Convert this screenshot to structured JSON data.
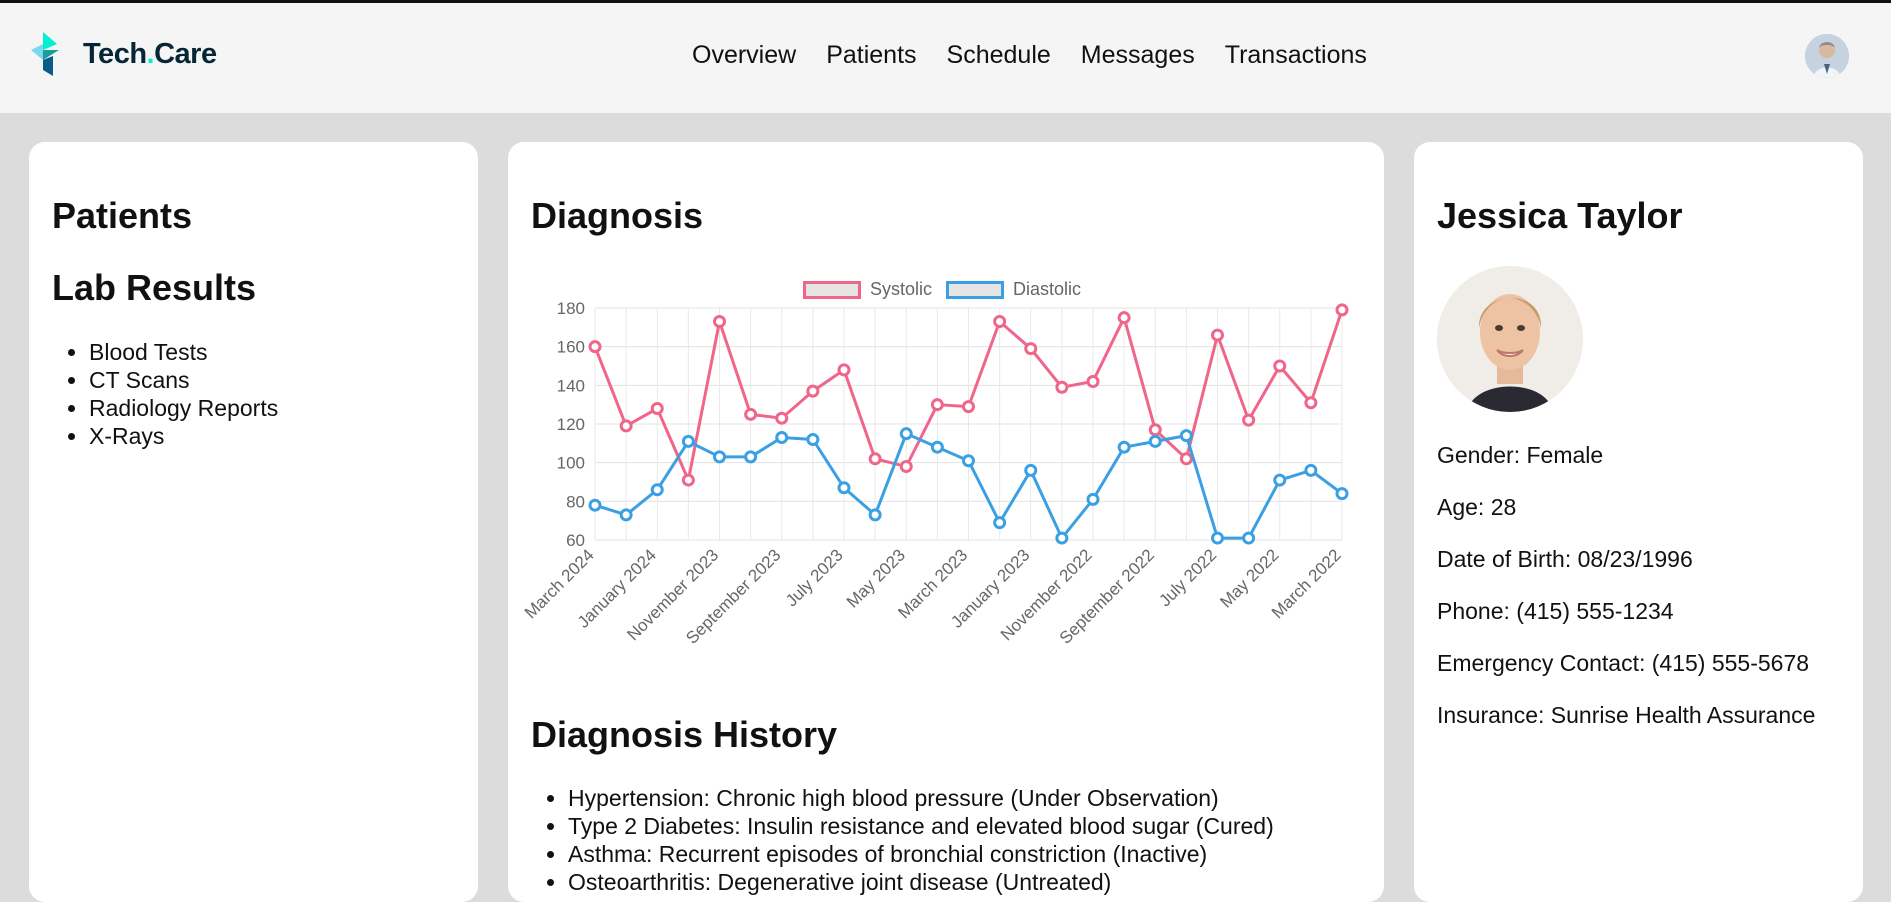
{
  "brand": {
    "name_main": "Tech",
    "name_dot": ".",
    "name_tail": "Care"
  },
  "nav": [
    "Overview",
    "Patients",
    "Schedule",
    "Messages",
    "Transactions"
  ],
  "left": {
    "title": "Patients",
    "lab_title": "Lab Results",
    "lab_items": [
      "Blood Tests",
      "CT Scans",
      "Radiology Reports",
      "X-Rays"
    ]
  },
  "middle": {
    "title": "Diagnosis",
    "history_title": "Diagnosis History",
    "history": [
      "Hypertension: Chronic high blood pressure (Under Observation)",
      "Type 2 Diabetes: Insulin resistance and elevated blood sugar (Cured)",
      "Asthma: Recurrent episodes of bronchial constriction (Inactive)",
      "Osteoarthritis: Degenerative joint disease (Untreated)"
    ]
  },
  "right": {
    "name": "Jessica Taylor",
    "gender": "Gender: Female",
    "age": "Age: 28",
    "dob": "Date of Birth: 08/23/1996",
    "phone": "Phone: (415) 555-1234",
    "emergency": "Emergency Contact: (415) 555-5678",
    "insurance": "Insurance: Sunrise Health Assurance"
  },
  "colors": {
    "systolic": "#f06589",
    "diastolic": "#3aa0e3",
    "brand_dark": "#072635",
    "brand_accent": "#01f0d0"
  },
  "chart_data": {
    "type": "line",
    "ylim": [
      60,
      180
    ],
    "yticks": [
      60,
      80,
      100,
      120,
      140,
      160,
      180
    ],
    "x_tick_labels": [
      "March 2024",
      "January 2024",
      "November 2023",
      "September 2023",
      "July 2023",
      "May 2023",
      "March 2023",
      "January 2023",
      "November 2022",
      "September 2022",
      "July 2022",
      "May 2022",
      "March 2022"
    ],
    "legend_position": "top-center",
    "grid": true,
    "series": [
      {
        "name": "Systolic",
        "color": "#f06589",
        "values": [
          160,
          119,
          128,
          91,
          173,
          125,
          123,
          137,
          148,
          102,
          98,
          130,
          129,
          173,
          159,
          139,
          142,
          175,
          117,
          102,
          166,
          122,
          150,
          131,
          179
        ]
      },
      {
        "name": "Diastolic",
        "color": "#3aa0e3",
        "values": [
          78,
          73,
          86,
          111,
          103,
          103,
          113,
          112,
          87,
          73,
          115,
          108,
          101,
          69,
          96,
          61,
          81,
          108,
          111,
          114,
          61,
          61,
          91,
          96,
          84
        ]
      }
    ]
  }
}
